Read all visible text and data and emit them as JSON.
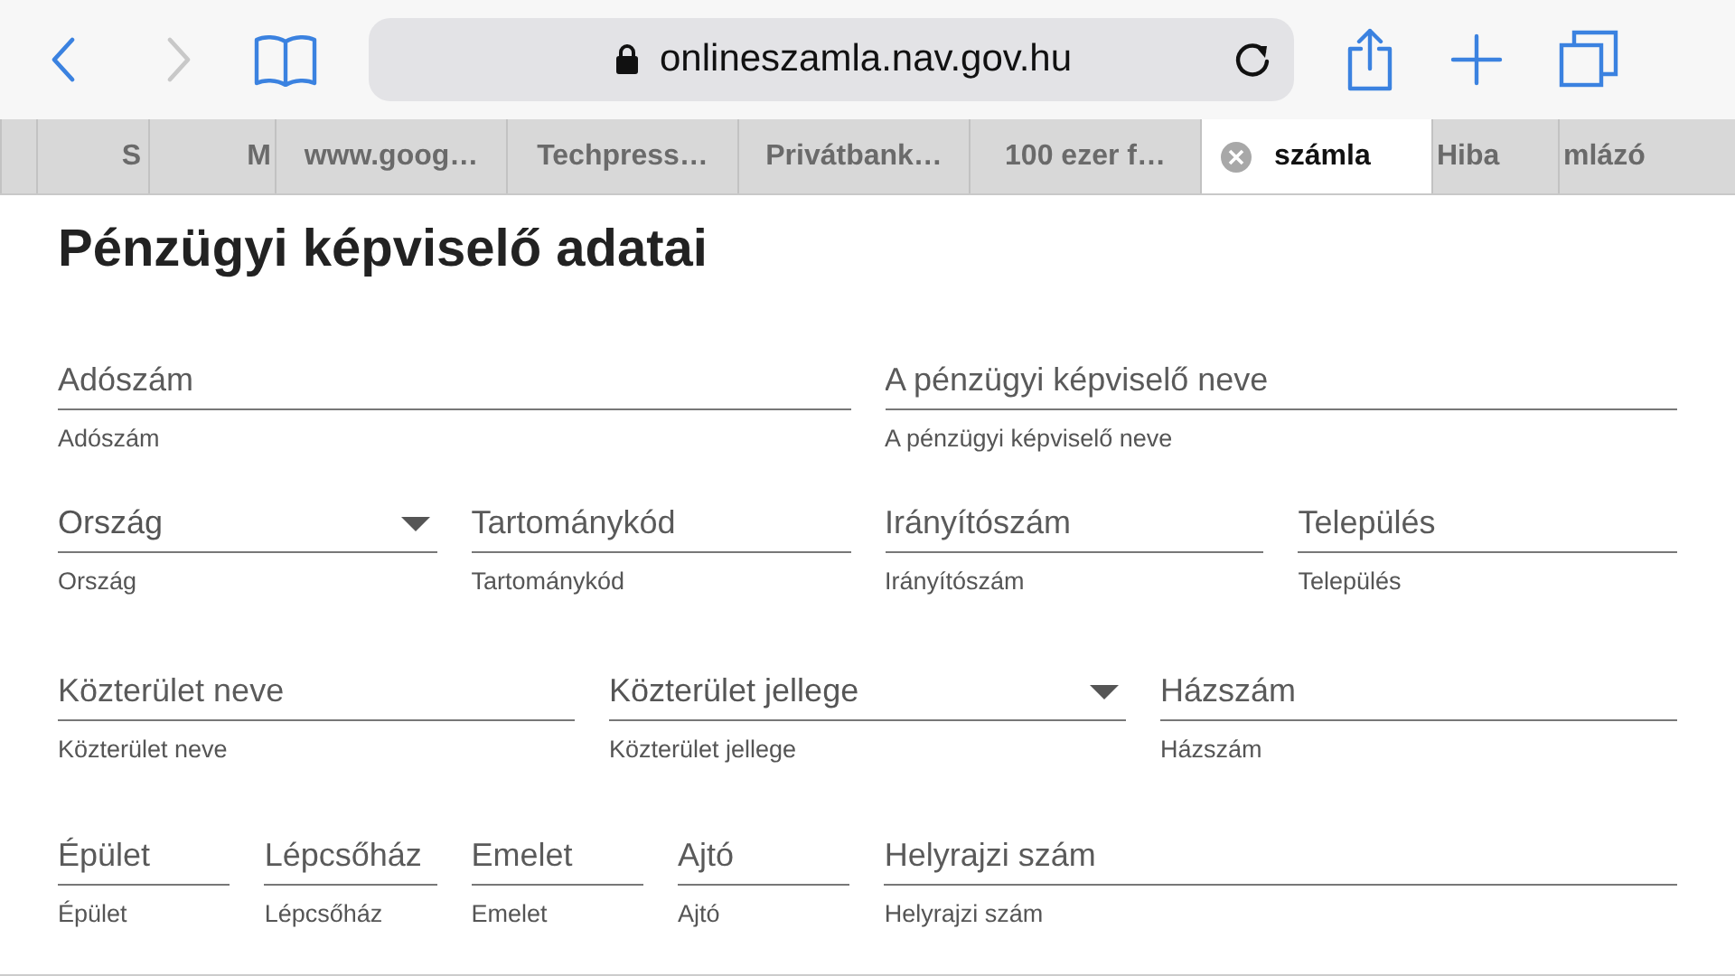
{
  "toolbar": {
    "back": {
      "disabled": false
    },
    "forward": {
      "disabled": true
    },
    "address": "onlineszamla.nav.gov.hu"
  },
  "tabs": [
    {
      "selected": false
    },
    {
      "label": "S",
      "selected": false
    },
    {
      "label": "M",
      "selected": false
    },
    {
      "label": "www.goog…",
      "selected": false
    },
    {
      "label": "Techpress…",
      "selected": false
    },
    {
      "label": "Privátbank…",
      "selected": false
    },
    {
      "label": "100 ezer f…",
      "selected": false
    },
    {
      "label": "számla",
      "selected": true
    },
    {
      "label": "Hiba",
      "selected": false
    },
    {
      "label": "mlázó",
      "selected": false
    }
  ],
  "page": {
    "title": "Pénzügyi képviselő adatai",
    "rows": [
      {
        "fields": [
          {
            "kind": "text",
            "placeholder": "Adószám",
            "helper": "Adószám"
          },
          {
            "kind": "text",
            "placeholder": "A pénzügyi képviselő neve",
            "helper": "A pénzügyi képviselő neve"
          }
        ]
      },
      {
        "fields": [
          {
            "kind": "select",
            "placeholder": "Ország",
            "helper": "Ország"
          },
          {
            "kind": "text",
            "placeholder": "Tartománykód",
            "helper": "Tartománykód"
          },
          {
            "kind": "text",
            "placeholder": "Irányítószám",
            "helper": "Irányítószám"
          },
          {
            "kind": "text",
            "placeholder": "Település",
            "helper": "Település"
          }
        ]
      },
      {
        "fields": [
          {
            "kind": "text",
            "placeholder": "Közterület neve",
            "helper": "Közterület neve"
          },
          {
            "kind": "select",
            "placeholder": "Közterület jellege",
            "helper": "Közterület jellege"
          },
          {
            "kind": "text",
            "placeholder": "Házszám",
            "helper": "Házszám"
          }
        ]
      },
      {
        "fields": [
          {
            "kind": "text",
            "placeholder": "Épület",
            "helper": "Épület"
          },
          {
            "kind": "text",
            "placeholder": "Lépcsőház",
            "helper": "Lépcsőház"
          },
          {
            "kind": "text",
            "placeholder": "Emelet",
            "helper": "Emelet"
          },
          {
            "kind": "text",
            "placeholder": "Ajtó",
            "helper": "Ajtó"
          },
          {
            "kind": "text",
            "placeholder": "Helyrajzi szám",
            "helper": "Helyrajzi szám"
          }
        ]
      }
    ]
  }
}
